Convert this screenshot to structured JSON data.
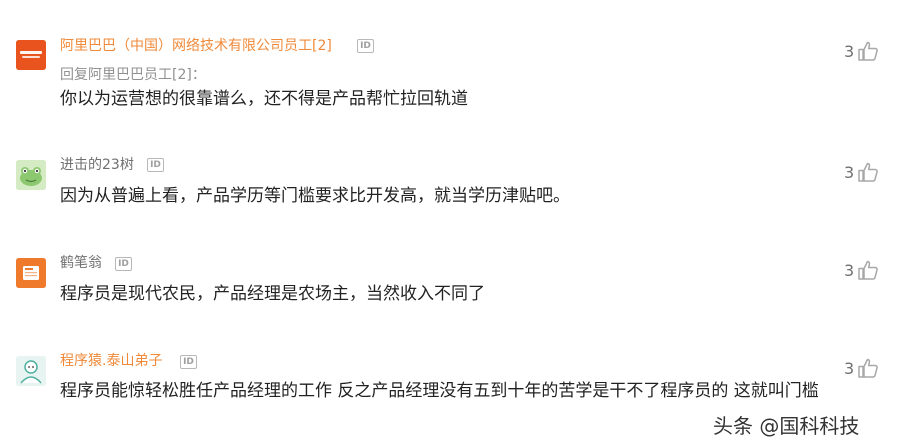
{
  "comments": [
    {
      "username": "阿里巴巴（中国）网络技术有限公司员工[2]",
      "badge": "ID",
      "reply_to": "回复阿里巴巴员工[2]：",
      "content": "你以为运营想的很靠谱么，还不得是产品帮忙拉回轨道",
      "likes": "3",
      "avatar_icon": "alibaba-logo-icon"
    },
    {
      "username": "进击的23树",
      "badge": "ID",
      "content": "因为从普遍上看，产品学历等门槛要求比开发高，就当学历津贴吧。",
      "likes": "3",
      "avatar_icon": "frog-icon"
    },
    {
      "username": "鹤笔翁",
      "badge": "ID",
      "content": "程序员是现代农民，产品经理是农场主，当然收入不同了",
      "likes": "3",
      "avatar_icon": "notebook-icon"
    },
    {
      "username": "程序猿.泰山弟子",
      "badge": "ID",
      "content": "程序员能惊轻松胜任产品经理的工作 反之产品经理没有五到十年的苦学是干不了程序员的 这就叫门槛",
      "likes": "3",
      "avatar_icon": "person-icon"
    }
  ],
  "watermark": "头条 @国科科技",
  "colors": {
    "username_orange": "#f08a3a",
    "username_gray": "#707070",
    "text": "#222222",
    "thumb": "#a8a8a8"
  }
}
